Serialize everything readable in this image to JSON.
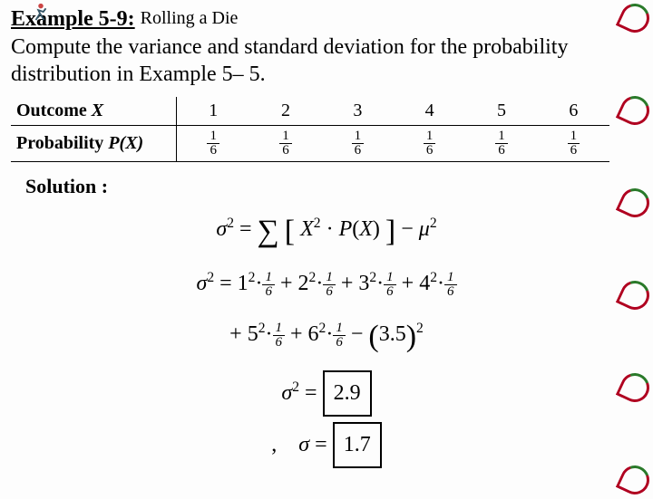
{
  "header": {
    "example_label": "Example 5-9:",
    "subtitle": "Rolling a Die"
  },
  "prompt": "Compute the variance and standard deviation for the probability distribution in Example 5– 5.",
  "table": {
    "row1_label": "Outcome",
    "row1_var": "X",
    "row2_label": "Probability",
    "row2_var": "P(X)",
    "outcomes": [
      "1",
      "2",
      "3",
      "4",
      "5",
      "6"
    ],
    "prob_num": "1",
    "prob_den": "6"
  },
  "solution_label": "Solution :",
  "eq": {
    "sigma": "σ",
    "mu": "μ",
    "eq_sign": "=",
    "plus": "+",
    "minus": "−",
    "dot": "·",
    "sum": "∑",
    "X": "X",
    "P": "P",
    "lpar": "(",
    "rpar": ")",
    "lbr": "[",
    "rbr": "]",
    "two": "2",
    "terms": [
      "1",
      "2",
      "3",
      "4",
      "5",
      "6"
    ],
    "mean": "3.5",
    "variance_boxed": "2.9",
    "sd_boxed": "1.7",
    "comma": ","
  },
  "chart_data": {
    "type": "table",
    "title": "Probability distribution of a fair die",
    "columns": [
      "Outcome X",
      "Probability P(X)"
    ],
    "rows": [
      [
        1,
        0.1667
      ],
      [
        2,
        0.1667
      ],
      [
        3,
        0.1667
      ],
      [
        4,
        0.1667
      ],
      [
        5,
        0.1667
      ],
      [
        6,
        0.1667
      ]
    ],
    "derived": {
      "mean": 3.5,
      "variance": 2.9,
      "std_dev": 1.7
    }
  }
}
